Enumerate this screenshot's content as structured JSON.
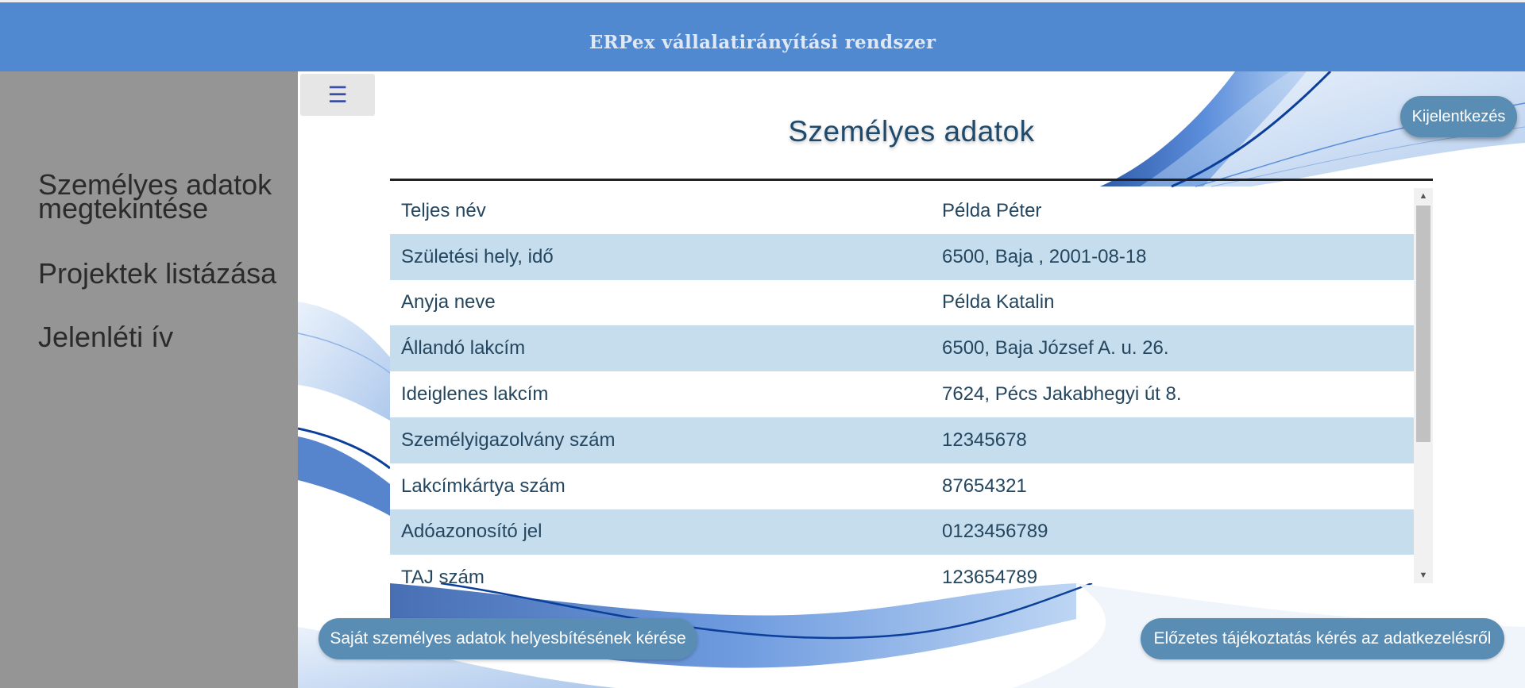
{
  "header": {
    "title": "ERPex vállalatirányítási rendszer"
  },
  "sidebar": {
    "items": [
      {
        "label": "Személyes adatok megtekintése"
      },
      {
        "label": "Projektek listázása"
      },
      {
        "label": "Jelenléti ív"
      }
    ]
  },
  "toolbar": {
    "menu_icon": "☰",
    "logout_label": "Kijelentkezés"
  },
  "main": {
    "title": "Személyes adatok",
    "rows": [
      {
        "label": "Teljes név",
        "value": "Példa Péter"
      },
      {
        "label": "Születési hely, idő",
        "value": "6500, Baja , 2001-08-18"
      },
      {
        "label": "Anyja neve",
        "value": "Példa Katalin"
      },
      {
        "label": "Állandó lakcím",
        "value": "6500, Baja József A. u. 26."
      },
      {
        "label": "Ideiglenes lakcím",
        "value": "7624, Pécs Jakabhegyi út 8."
      },
      {
        "label": "Személyigazolvány szám",
        "value": "12345678"
      },
      {
        "label": "Lakcímkártya szám",
        "value": "87654321"
      },
      {
        "label": "Adóazonosító jel",
        "value": "0123456789"
      },
      {
        "label": "TAJ szám",
        "value": "123654789"
      }
    ],
    "actions": {
      "correction_request": "Saját személyes adatok helyesbítésének kérése",
      "info_request": "Előzetes tájékoztatás kérés az adatkezelésről"
    }
  },
  "colors": {
    "header_bg": "#5189d1",
    "sidebar_bg": "#959595",
    "row_alt": "#c6ddee",
    "button_bg": "#5a8db3",
    "text_primary": "#24465f"
  },
  "icons": [
    "menu-icon",
    "scroll-up-arrow-icon",
    "scroll-down-arrow-icon"
  ]
}
